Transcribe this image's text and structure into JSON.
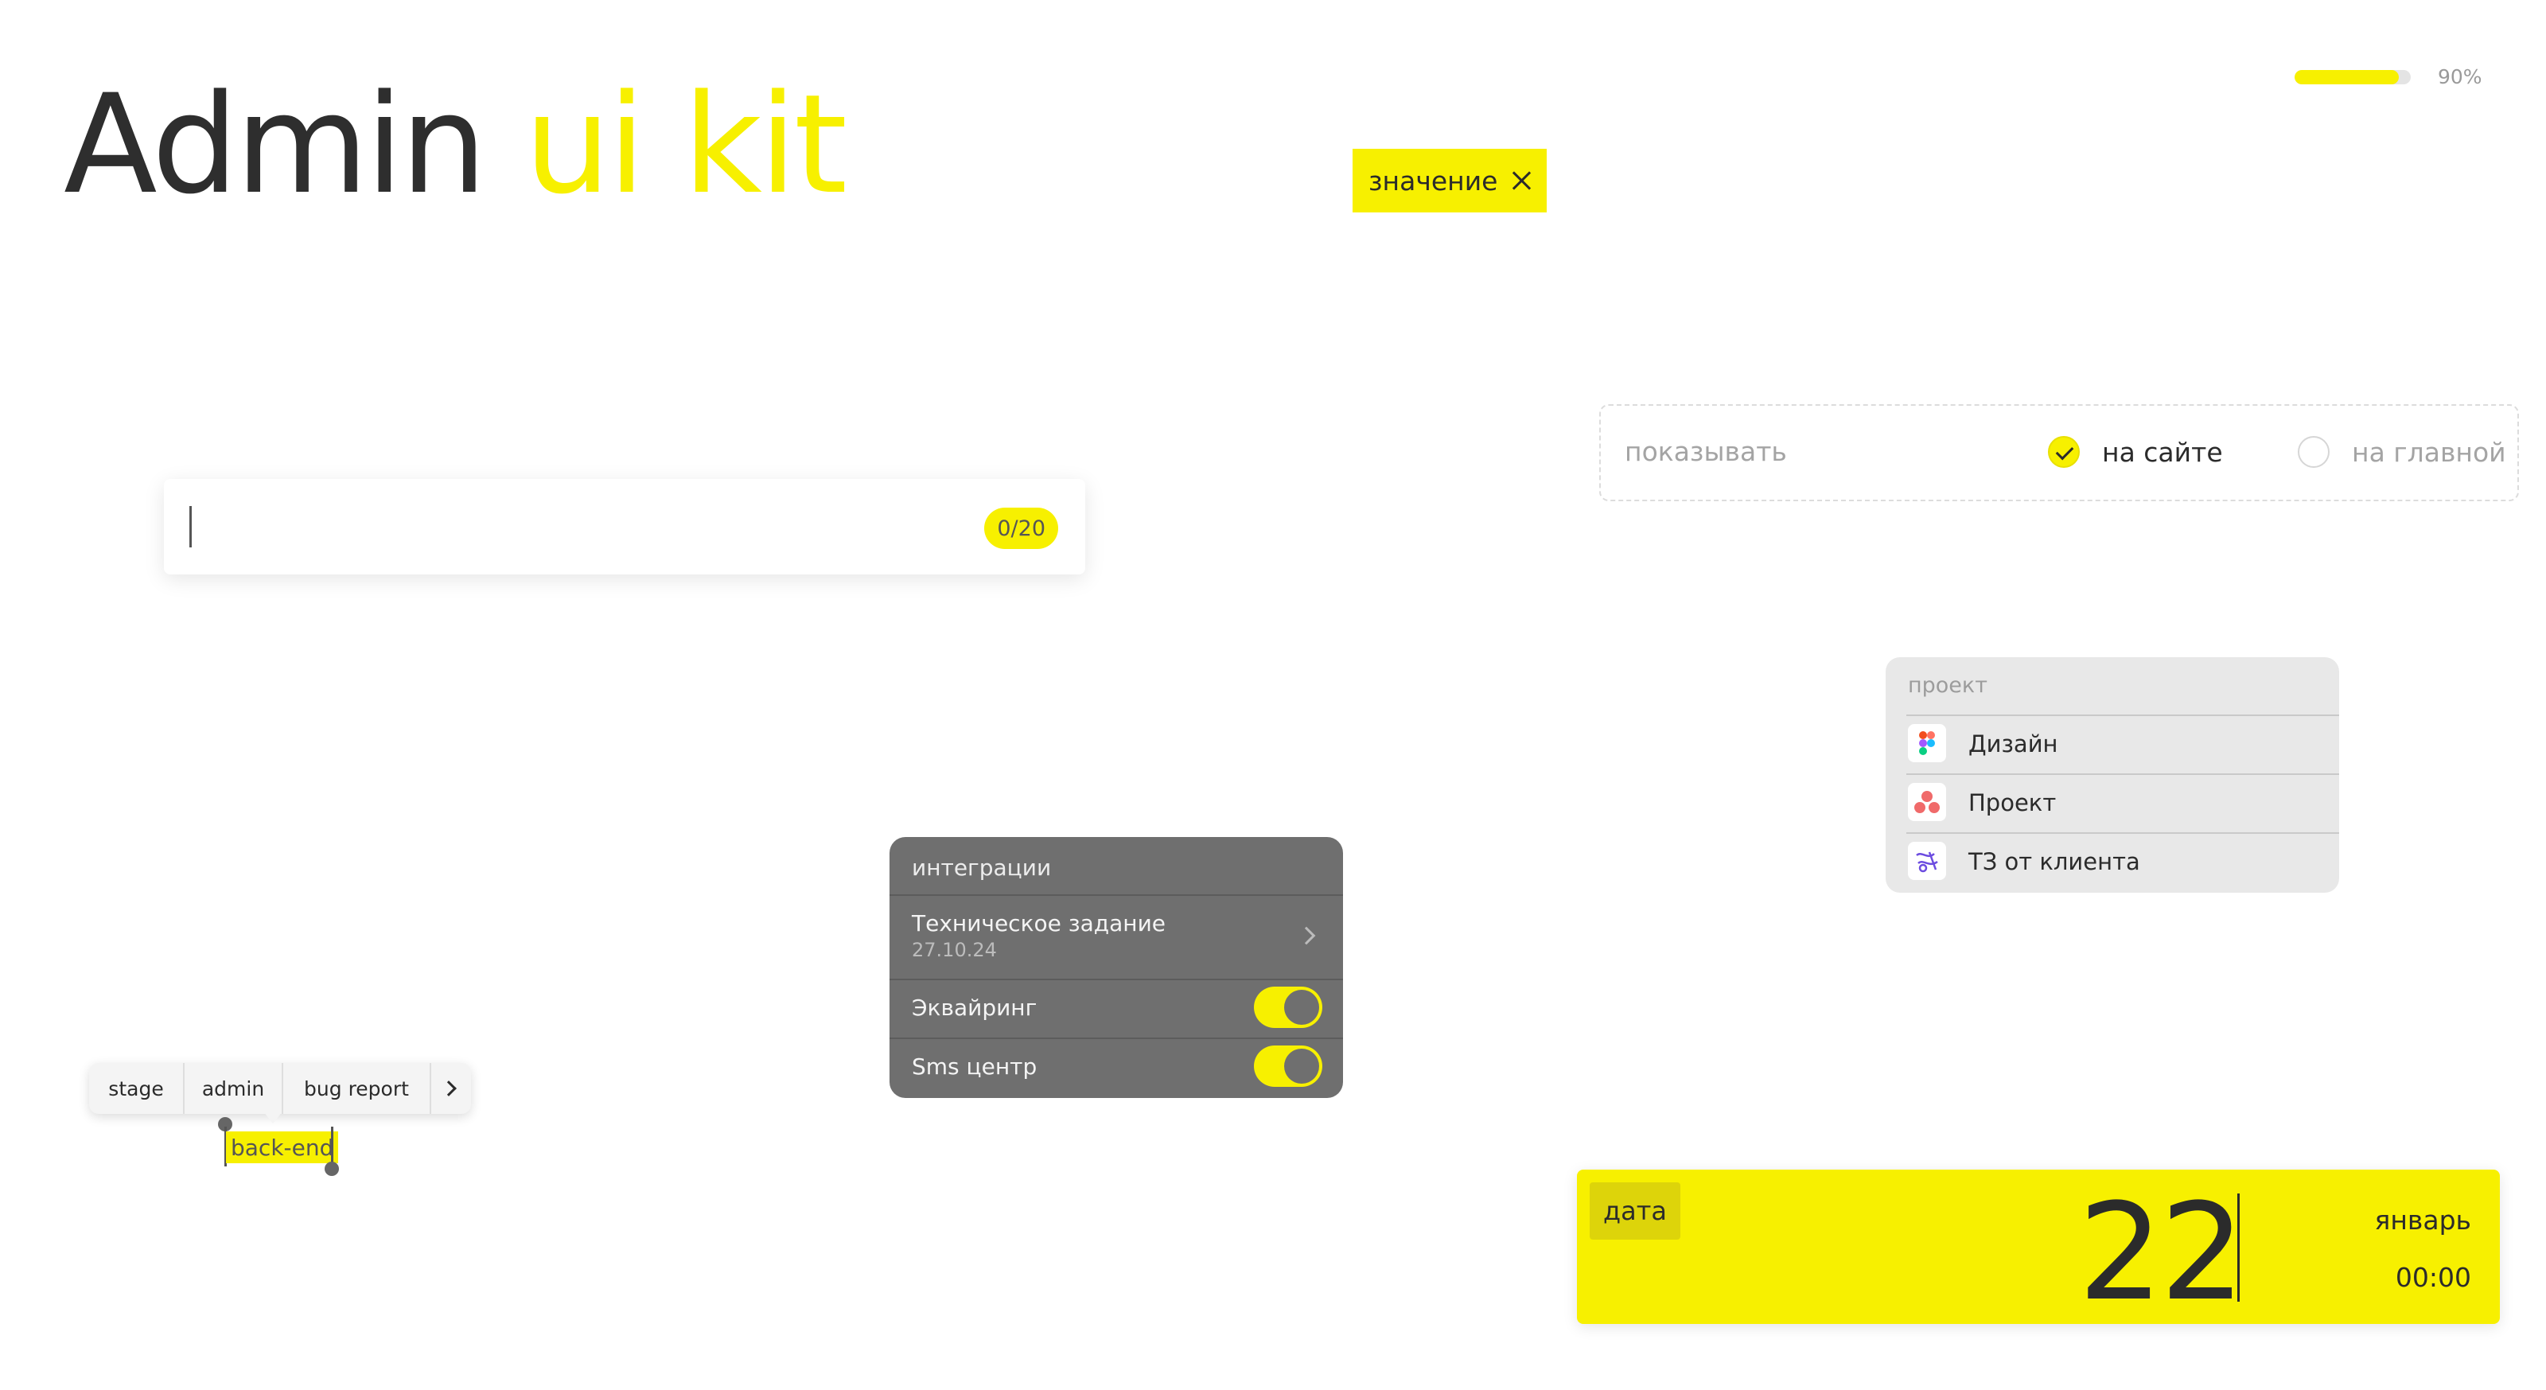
{
  "title": {
    "part1": "Admin",
    "part2": "ui kit"
  },
  "progress": {
    "value": 0.9,
    "label": "90%"
  },
  "chip": {
    "label": "значение"
  },
  "text_input": {
    "value": "",
    "counter": "0/20"
  },
  "radio_group": {
    "label": "показывать",
    "options": [
      {
        "label": "на сайте",
        "selected": true
      },
      {
        "label": "на главной",
        "selected": false
      }
    ]
  },
  "project_list": {
    "header": "проект",
    "items": [
      {
        "label": "Дизайн",
        "icon": "figma-icon"
      },
      {
        "label": "Проект",
        "icon": "asana-icon"
      },
      {
        "label": "ТЗ от клиента",
        "icon": "document-sketch-icon"
      }
    ]
  },
  "integrations": {
    "header": "интеграции",
    "rows": [
      {
        "label": "Техническое задание",
        "sub": "27.10.24",
        "type": "link"
      },
      {
        "label": "Эквайринг",
        "type": "toggle",
        "on": true
      },
      {
        "label": "Sms центр",
        "type": "toggle",
        "on": true
      }
    ]
  },
  "context_menu": {
    "items": [
      "stage",
      "admin",
      "bug report"
    ],
    "selected_text": "back-end"
  },
  "date_picker": {
    "label": "дата",
    "day": "22",
    "month": "январь",
    "time": "00:00"
  },
  "colors": {
    "accent": "#f7f000",
    "text": "#2b2b2b",
    "panel_dark": "#6f6f6f",
    "panel_light": "#e8e8e8"
  }
}
